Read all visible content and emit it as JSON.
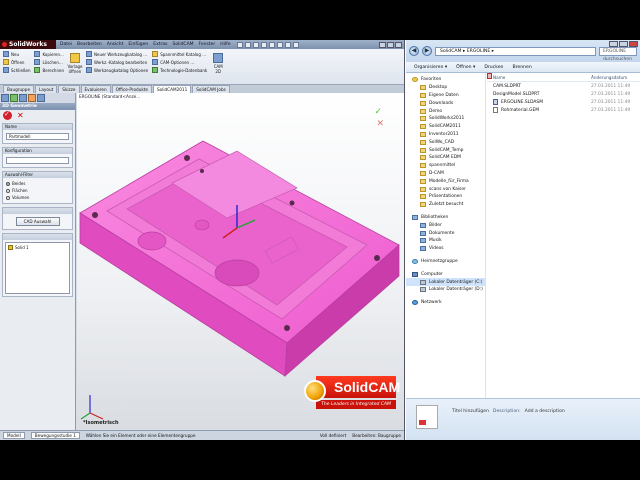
{
  "solidworks": {
    "app_name": "SolidWorks",
    "menu": [
      "Datei",
      "Bearbeiten",
      "Ansicht",
      "Einfügen",
      "Extras",
      "SolidCAM",
      "Fenster",
      "Hilfe"
    ],
    "ribbon": {
      "col1": [
        "Neu",
        "Öffnen",
        "Schließen"
      ],
      "col2": [
        "Kopieren...",
        "Löschen...",
        "Berechnen"
      ],
      "big1": "Vorlage öffnen",
      "col3": [
        "Neuer Werkzeugkatalog ...",
        "Werkz.-Katalog bearbeiten",
        "Werkzeugkatalog Optionen"
      ],
      "col4": [
        "Spannmittel Katalog ...",
        "CAM-Optionen ...",
        "Technologie-Datenbank"
      ],
      "big2": "CAM 2D"
    },
    "tabs": [
      "Baugruppe",
      "Layout",
      "Skizze",
      "Evaluieren",
      "Office-Produkte",
      "SolidCAM2011",
      "SolidCAM Jobs"
    ],
    "active_tab": "SolidCAM2011",
    "panel": {
      "title": "3D Geometrie",
      "name_label": "Name",
      "name_value": "Partmodell",
      "config_label": "Konfiguration",
      "filter_label": "Auswahl-Filter",
      "filters": [
        "Beides",
        "Flächen",
        "Volumen"
      ],
      "selected_filter": "Beides",
      "cad_button": "CAD Auswahl",
      "list_item": "Solid 1"
    },
    "viewport": {
      "breadcrumb": "ERGOLINE (Standard<Anze...",
      "view_label": "*Isometrisch",
      "model_color": "#f56bd6"
    },
    "brand": {
      "name": "SolidCAM",
      "tagline": "The Leaders in Integrated CAM"
    },
    "status": {
      "tabs": [
        "Modell",
        "Bewegungsstudie 1"
      ],
      "hint": "Wählen Sie ein Element oder eine Elementengruppe",
      "state": "Voll definiert",
      "mode": "Bearbeiten: Baugruppe"
    }
  },
  "explorer": {
    "breadcrumb": "SolidCAM ▸ ERGOLINE ▸",
    "search_placeholder": "ERGOLINE durchsuchen",
    "commands": [
      "Organisieren ▾",
      "Öffnen ▾",
      "Drucken",
      "Brennen"
    ],
    "favorites_header": "Favoriten",
    "favorites": [
      "Desktop",
      "Eigene Daten",
      "Downloads",
      "Demo",
      "SolidWorks2011",
      "SolidCAM2011",
      "Inventor2011",
      "SolWo_CAD",
      "SolidCAM_Temp",
      "SolidCAM EDM",
      "spannmittel",
      "D-CAM",
      "Modelle_für_Firma",
      "scans von Kaiser",
      "Präsentationen",
      "Zuletzt besucht"
    ],
    "libraries_header": "Bibliotheken",
    "libraries": [
      "Bilder",
      "Dokumente",
      "Musik",
      "Videos"
    ],
    "homegroup": "Heimnetzgruppe",
    "computer_header": "Computer",
    "drives": [
      "Lokaler Datenträger (C:)",
      "Lokaler Datenträger (D:)"
    ],
    "network": "Netzwerk",
    "columns": {
      "name": "Name",
      "date": "Änderungsdatum"
    },
    "files": [
      {
        "name": "CAM.SLDPRT",
        "date": "27.03.2011 11:49",
        "type": "sw"
      },
      {
        "name": "DesignModel.SLDPRT",
        "date": "27.03.2011 11:49",
        "type": "sw"
      },
      {
        "name": "ERGOLINE.SLDASM",
        "date": "27.03.2011 11:49",
        "type": "asm"
      },
      {
        "name": "Rohmaterial.GEM",
        "date": "27.03.2011 11:49",
        "type": "doc"
      }
    ],
    "details": {
      "title_label": "Titel hinzufügen",
      "desc_label": "Description:",
      "desc_value": "Add a description"
    }
  }
}
